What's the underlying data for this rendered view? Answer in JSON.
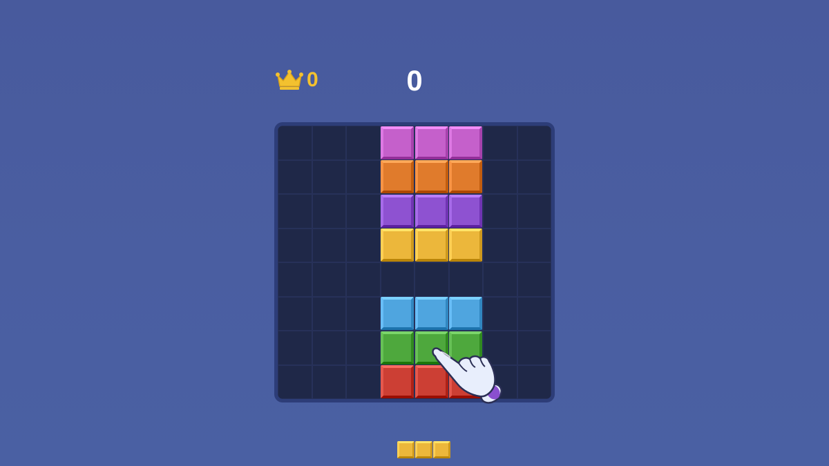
{
  "hud": {
    "best_icon": "crown-icon",
    "best_value": "0",
    "score": "0"
  },
  "board": {
    "rows": 8,
    "cols": 8,
    "blocks": [
      {
        "row": 0,
        "col": 3,
        "color": "#c560cb"
      },
      {
        "row": 0,
        "col": 4,
        "color": "#c560cb"
      },
      {
        "row": 0,
        "col": 5,
        "color": "#c560cb"
      },
      {
        "row": 1,
        "col": 3,
        "color": "#e07b2c"
      },
      {
        "row": 1,
        "col": 4,
        "color": "#e07b2c"
      },
      {
        "row": 1,
        "col": 5,
        "color": "#e07b2c"
      },
      {
        "row": 2,
        "col": 3,
        "color": "#8e52d1"
      },
      {
        "row": 2,
        "col": 4,
        "color": "#8e52d1"
      },
      {
        "row": 2,
        "col": 5,
        "color": "#8e52d1"
      },
      {
        "row": 3,
        "col": 3,
        "color": "#ecb73b"
      },
      {
        "row": 3,
        "col": 4,
        "color": "#ecb73b"
      },
      {
        "row": 3,
        "col": 5,
        "color": "#ecb73b"
      },
      {
        "row": 5,
        "col": 3,
        "color": "#4fa5df"
      },
      {
        "row": 5,
        "col": 4,
        "color": "#4fa5df"
      },
      {
        "row": 5,
        "col": 5,
        "color": "#4fa5df"
      },
      {
        "row": 6,
        "col": 3,
        "color": "#4ea83d"
      },
      {
        "row": 6,
        "col": 4,
        "color": "#4ea83d"
      },
      {
        "row": 6,
        "col": 5,
        "color": "#4ea83d"
      },
      {
        "row": 7,
        "col": 3,
        "color": "#cc3f34"
      },
      {
        "row": 7,
        "col": 4,
        "color": "#cc3f34"
      },
      {
        "row": 7,
        "col": 5,
        "color": "#cc3f34"
      }
    ]
  },
  "tray": {
    "piece": {
      "color": "#ecb73b",
      "cells": 3
    }
  },
  "tutorial": {
    "hand_icon": "pointing-hand-icon"
  },
  "colors": {
    "background": "#4a5ea1",
    "board_frame": "#2d3d78",
    "board_cell": "#1f2848",
    "crown": "#f3c12f",
    "score_text": "#ffffff"
  }
}
